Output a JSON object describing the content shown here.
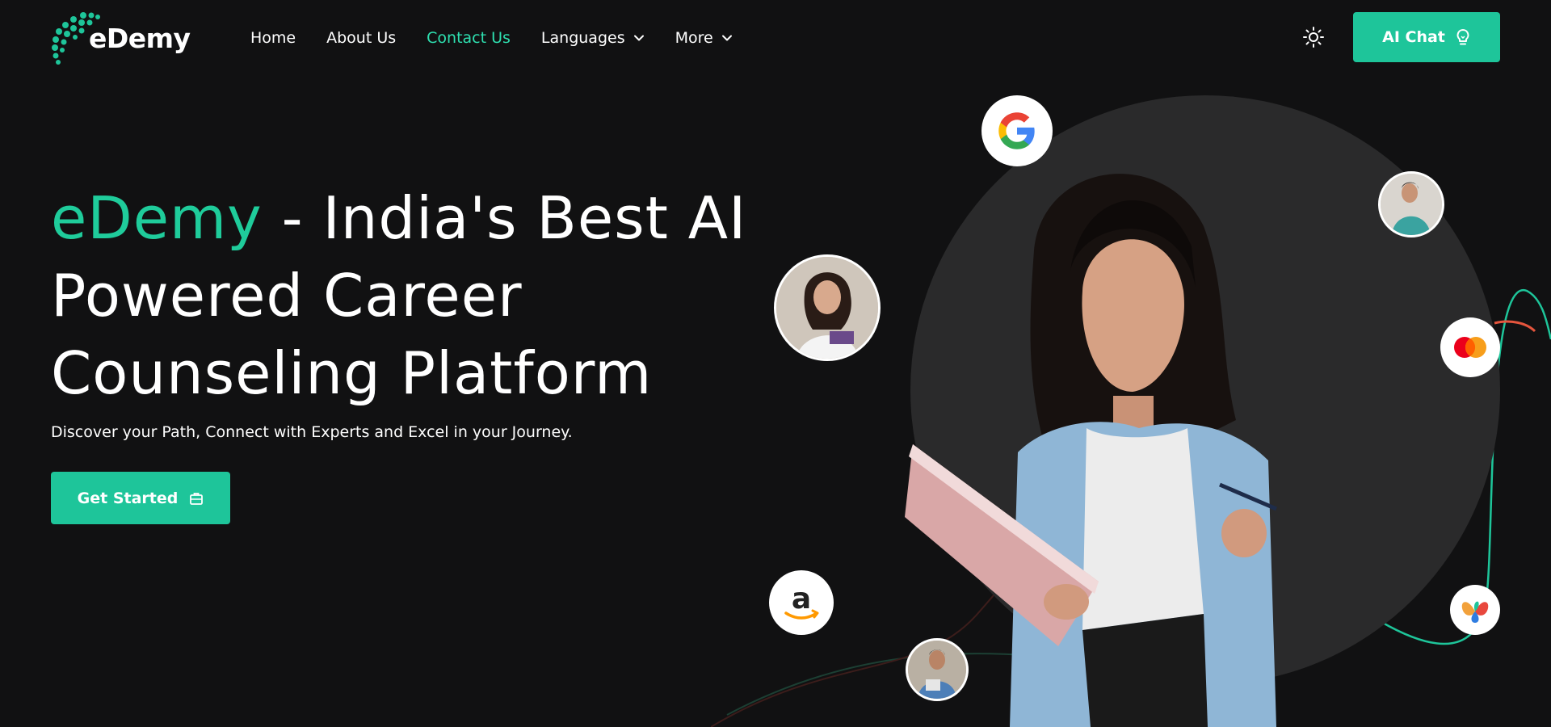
{
  "header": {
    "logo_text": "eDemy",
    "nav": [
      {
        "label": "Home",
        "active": false,
        "dropdown": false
      },
      {
        "label": "About Us",
        "active": false,
        "dropdown": false
      },
      {
        "label": "Contact Us",
        "active": true,
        "dropdown": false
      },
      {
        "label": "Languages",
        "active": false,
        "dropdown": true
      },
      {
        "label": "More",
        "active": false,
        "dropdown": true
      }
    ],
    "theme_icon": "sun-icon",
    "ai_chat_label": "AI Chat",
    "ai_chat_icon": "bulb-icon"
  },
  "hero": {
    "title_accent": "eDemy",
    "title_rest": " - India's Best AI Powered Career Counseling Platform",
    "subtitle": "Discover your Path, Connect with Experts and Excel in your Journey.",
    "cta_label": "Get Started",
    "cta_icon": "briefcase-icon"
  },
  "partner_logos": [
    "google-logo",
    "mastercard-logo",
    "amazon-logo",
    "butterfly-logo"
  ],
  "colors": {
    "background": "#111112",
    "accent": "#1ec59a",
    "accent_text": "#1fcc9b",
    "nav_active": "#2ee0b0",
    "circle": "#2a2a2b"
  }
}
